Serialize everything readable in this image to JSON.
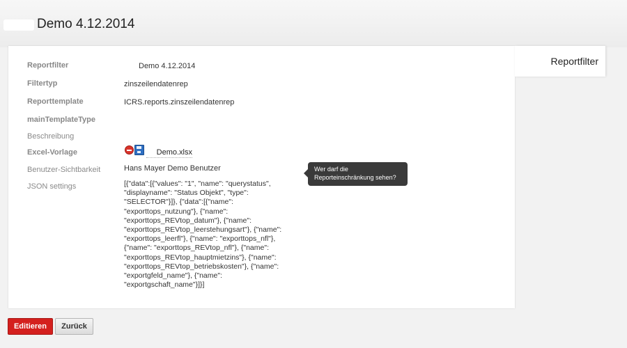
{
  "header": {
    "title": "Demo 4.12.2014"
  },
  "side_tab": {
    "label": "Reportfilter"
  },
  "fields": {
    "reportfilter": {
      "label": "Reportfilter",
      "value": "Demo 4.12.2014"
    },
    "filtertyp": {
      "label": "Filtertyp",
      "value": "zinszeilendatenrep"
    },
    "reporttemplate": {
      "label": "Reporttemplate",
      "value": "ICRS.reports.zinszeilendatenrep"
    },
    "main_template_type": {
      "label": "mainTemplateType",
      "value": ""
    },
    "beschreibung": {
      "label": "Beschreibung",
      "value": ""
    },
    "excel_vorlage": {
      "label": "Excel-Vorlage",
      "value": "Demo.xlsx"
    },
    "benutzer_sichtbarkeit": {
      "label": "Benutzer-Sichtbarkeit",
      "value": "Hans Mayer Demo Benutzer"
    },
    "json_settings": {
      "label": "JSON settings",
      "value": "[{\"data\":[{\"values\": \"1\", \"name\": \"querystatus\", \"displayname\": \"Status Objekt\", \"type\": \"SELECTOR\"}]}, {\"data\":[{\"name\": \"exporttops_nutzung\"}, {\"name\": \"exporttops_REVtop_datum\"}, {\"name\": \"exporttops_REVtop_leerstehungsart\"}, {\"name\": \"exporttops_leerfl\"}, {\"name\": \"exporttops_nfl\"}, {\"name\": \"exporttops_REVtop_nfl\"}, {\"name\": \"exporttops_REVtop_hauptmietzins\"}, {\"name\": \"exporttops_REVtop_betriebskosten\"}, {\"name\": \"exportgfeld_name\"}, {\"name\": \"exportgschaft_name\"}]}]"
    }
  },
  "tooltip": {
    "text": "Wer darf die Reporteinschränkung sehen?"
  },
  "buttons": {
    "edit": "Editieren",
    "back": "Zurück"
  },
  "colors": {
    "primary_button": "#d4201e",
    "tooltip_bg": "#3a3a3a"
  }
}
